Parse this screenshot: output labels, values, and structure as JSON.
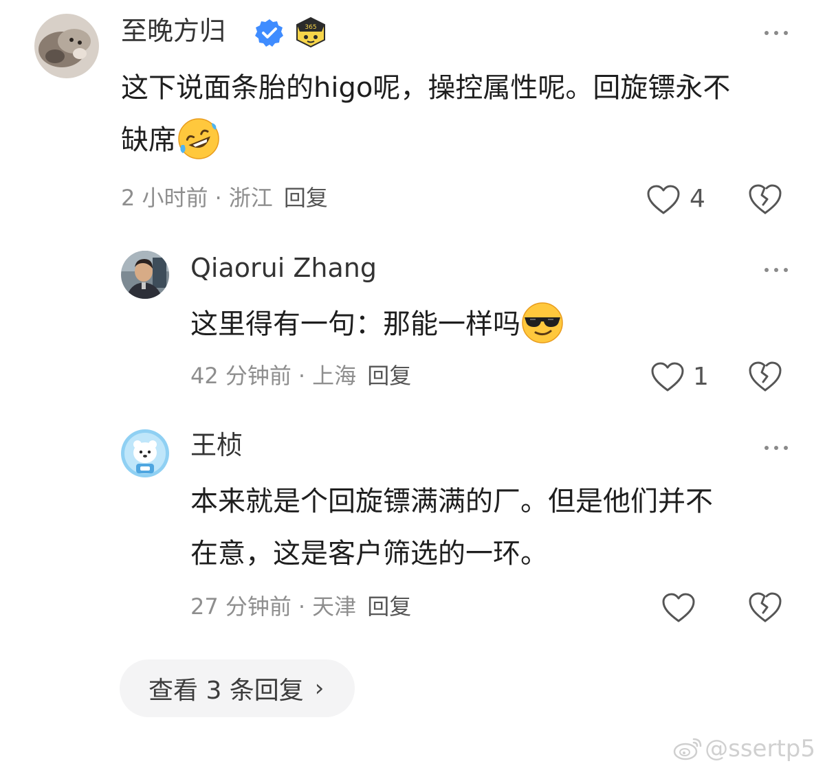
{
  "comments": [
    {
      "username": "至晚方归",
      "verified_icon": "verified-badge-icon",
      "fan_badge_icon": "fan-badge-365-icon",
      "fan_badge_text": "365",
      "text_line1": "这下说面条胎的higo呢，操控属性呢。回旋镖永不",
      "text_line2": "缺席",
      "emoji": "rofl-emoji",
      "time": "2 小时前",
      "separator": "·",
      "location": "浙江",
      "reply_label": "回复",
      "like_count": "4"
    },
    {
      "username": "Qiaorui Zhang",
      "text_line1": "这里得有一句：那能一样吗",
      "emoji": "sunglasses-emoji",
      "time": "42 分钟前",
      "separator": "·",
      "location": "上海",
      "reply_label": "回复",
      "like_count": "1"
    },
    {
      "username": "王桢",
      "text_line1": "本来就是个回旋镖满满的厂。但是他们并不",
      "text_line2": "在意，这是客户筛选的一环。",
      "time": "27 分钟前",
      "separator": "·",
      "location": "天津",
      "reply_label": "回复",
      "like_count": ""
    }
  ],
  "view_more": {
    "label": "查看 3 条回复",
    "chevron": "›"
  },
  "watermark": {
    "text": "@ssertp5",
    "icon": "weibo-logo-icon"
  },
  "colors": {
    "verified_blue": "#3f8cff",
    "meta_gray": "#8e8e8e",
    "pill_bg": "#f4f4f5"
  }
}
